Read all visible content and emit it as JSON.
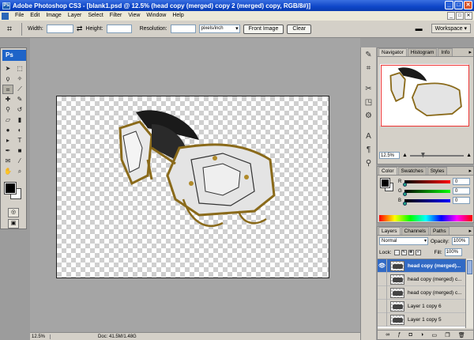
{
  "window": {
    "title": "Adobe Photoshop CS3 - [blank1.psd @ 12.5% (head copy (merged) copy 2 (merged) copy, RGB/8#)]",
    "app_icon_text": "Ps",
    "min": "_",
    "max": "□",
    "close": "✕"
  },
  "menu": [
    "File",
    "Edit",
    "Image",
    "Layer",
    "Select",
    "Filter",
    "View",
    "Window",
    "Help"
  ],
  "doc_buttons": [
    "_",
    "□",
    "✕"
  ],
  "options": {
    "width_label": "Width:",
    "height_label": "Height:",
    "resolution_label": "Resolution:",
    "units": "pixels/inch",
    "front_image": "Front Image",
    "clear": "Clear",
    "workspace": "Workspace ▾"
  },
  "toolbox": {
    "logo": "Ps",
    "tools": [
      {
        "name": "move-tool",
        "glyph": "➤"
      },
      {
        "name": "marquee-tool",
        "glyph": "⬚"
      },
      {
        "name": "lasso-tool",
        "glyph": "ϙ"
      },
      {
        "name": "magic-wand-tool",
        "glyph": "✧"
      },
      {
        "name": "crop-tool",
        "glyph": "⌗"
      },
      {
        "name": "slice-tool",
        "glyph": "⟋"
      },
      {
        "name": "healing-brush-tool",
        "glyph": "✚"
      },
      {
        "name": "brush-tool",
        "glyph": "✎"
      },
      {
        "name": "clone-stamp-tool",
        "glyph": "⚲"
      },
      {
        "name": "history-brush-tool",
        "glyph": "↺"
      },
      {
        "name": "eraser-tool",
        "glyph": "▱"
      },
      {
        "name": "gradient-tool",
        "glyph": "▮"
      },
      {
        "name": "blur-tool",
        "glyph": "●"
      },
      {
        "name": "dodge-tool",
        "glyph": "◐"
      },
      {
        "name": "path-selection-tool",
        "glyph": "▸"
      },
      {
        "name": "type-tool",
        "glyph": "T"
      },
      {
        "name": "pen-tool",
        "glyph": "✒"
      },
      {
        "name": "shape-tool",
        "glyph": "■"
      },
      {
        "name": "notes-tool",
        "glyph": "✉"
      },
      {
        "name": "eyedropper-tool",
        "glyph": "⁄"
      },
      {
        "name": "hand-tool",
        "glyph": "✋"
      },
      {
        "name": "zoom-tool",
        "glyph": "⌕"
      }
    ]
  },
  "status": {
    "zoom": "12.5%",
    "doc": "Doc: 41.5M/1.48G"
  },
  "navigator": {
    "tabs": [
      "Navigator",
      "Histogram",
      "Info"
    ],
    "zoom": "12.5%"
  },
  "color": {
    "tabs": [
      "Color",
      "Swatches",
      "Styles"
    ],
    "channels": [
      {
        "label": "R",
        "value": "0",
        "color": "#e02020"
      },
      {
        "label": "G",
        "value": "0",
        "color": "#20c020"
      },
      {
        "label": "B",
        "value": "0",
        "color": "#2040e0"
      }
    ]
  },
  "layers": {
    "tabs": [
      "Layers",
      "Channels",
      "Paths"
    ],
    "blend_mode": "Normal",
    "opacity_label": "Opacity:",
    "opacity": "100%",
    "lock_label": "Lock:",
    "fill_label": "Fill:",
    "fill": "100%",
    "items": [
      {
        "name": "head copy (merged)...",
        "selected": true,
        "visible": true
      },
      {
        "name": "head copy (merged) c...",
        "selected": false,
        "visible": false
      },
      {
        "name": "head copy (merged) c...",
        "selected": false,
        "visible": false
      },
      {
        "name": "Layer 1 copy 6",
        "selected": false,
        "visible": false
      },
      {
        "name": "Layer 1 copy 5",
        "selected": false,
        "visible": false
      }
    ],
    "footer_icons": [
      "link-icon",
      "fx-icon",
      "mask-icon",
      "adjustment-icon",
      "group-icon",
      "new-layer-icon",
      "trash-icon"
    ]
  }
}
